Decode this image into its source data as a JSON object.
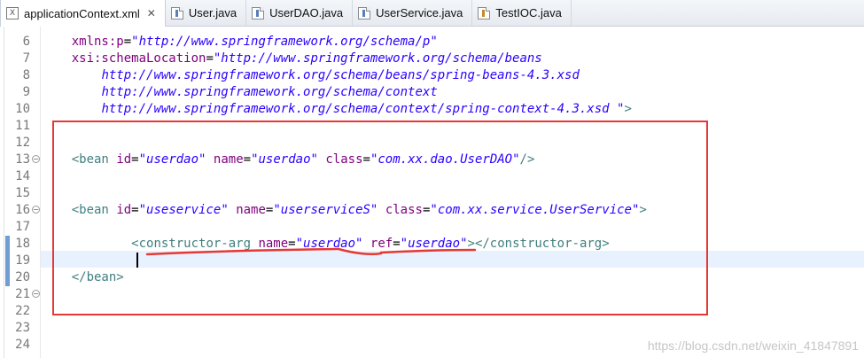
{
  "tabs": [
    {
      "label": "applicationContext.xml",
      "icon": "xml-file-icon",
      "active": true,
      "close": "✕"
    },
    {
      "label": "User.java",
      "icon": "java-file-icon"
    },
    {
      "label": "UserDAO.java",
      "icon": "java-file-icon"
    },
    {
      "label": "UserService.java",
      "icon": "java-file-icon"
    },
    {
      "label": "TestIOC.java",
      "icon": "java-test-file-icon"
    }
  ],
  "editor": {
    "lines": [
      {
        "n": "6",
        "code": "    xmlns:p=\"http://www.springframework.org/schema/p\""
      },
      {
        "n": "7",
        "code": "    xsi:schemaLocation=\"http://www.springframework.org/schema/beans"
      },
      {
        "n": "8",
        "code": "        http://www.springframework.org/schema/beans/spring-beans-4.3.xsd"
      },
      {
        "n": "9",
        "code": "        http://www.springframework.org/schema/context"
      },
      {
        "n": "10",
        "code": "        http://www.springframework.org/schema/context/spring-context-4.3.xsd \">"
      },
      {
        "n": "11",
        "code": ""
      },
      {
        "n": "12",
        "code": ""
      },
      {
        "n": "13",
        "code": "    <bean id=\"userdao\" name=\"userdao\" class=\"com.xx.dao.UserDAO\"/>",
        "fold": true
      },
      {
        "n": "14",
        "code": ""
      },
      {
        "n": "15",
        "code": ""
      },
      {
        "n": "16",
        "code": "    <bean id=\"useservice\" name=\"userserviceS\" class=\"com.xx.service.UserService\">",
        "fold": true
      },
      {
        "n": "17",
        "code": ""
      },
      {
        "n": "18",
        "code": "            <constructor-arg name=\"userdao\" ref=\"userdao\"></constructor-arg>"
      },
      {
        "n": "19",
        "code": ""
      },
      {
        "n": "20",
        "code": "    </bean>"
      },
      {
        "n": "21",
        "code": "",
        "fold": true
      },
      {
        "n": "22",
        "code": ""
      },
      {
        "n": "23",
        "code": ""
      },
      {
        "n": "24",
        "code": ""
      }
    ]
  },
  "fold_glyph": "−",
  "watermark": "https://blog.csdn.net/weixin_41847891",
  "colors": {
    "tag": "#3f7f7f",
    "attribute": "#7f007f",
    "value": "#2a00ff",
    "highlight_box": "#e53935",
    "current_line": "#e8f2fe"
  }
}
